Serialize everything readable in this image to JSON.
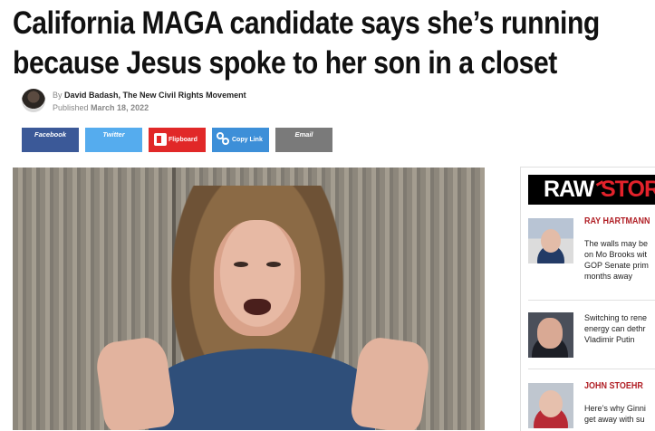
{
  "article": {
    "headline_line1": "California MAGA candidate says she’s running",
    "headline_line2": "because Jesus spoke to her son in a closet",
    "by_label": "By",
    "author": "David Badash, The New Civil Rights Movement",
    "published_label": "Published",
    "published_date": "March 18, 2022"
  },
  "share_buttons": [
    {
      "label": "Facebook",
      "color": "#3b5998"
    },
    {
      "label": "Twitter",
      "color": "#55acee"
    },
    {
      "label": "Flipboard",
      "color": "#e12828",
      "icon": "flipboard-icon"
    },
    {
      "label": "Copy Link",
      "color": "#3d8fd8",
      "icon": "link-icon"
    },
    {
      "label": "Email",
      "color": "#7a7a7a"
    }
  ],
  "sidebar": {
    "logo_part1": "RAW",
    "logo_part2": "STOR",
    "stories": [
      {
        "author": "RAY HARTMANN",
        "text_lines": [
          "The walls may be",
          "on Mo Brooks wit",
          "GOP Senate prim",
          "months away"
        ]
      },
      {
        "author": "",
        "text_lines": [
          "Switching to rene",
          "energy can dethr",
          "Vladimir Putin"
        ]
      },
      {
        "author": "JOHN STOEHR",
        "text_lines": [
          "Here’s why Ginni",
          "get away with su"
        ]
      }
    ]
  },
  "colors": {
    "brand_red": "#e3222b",
    "author_red": "#b01e24"
  }
}
